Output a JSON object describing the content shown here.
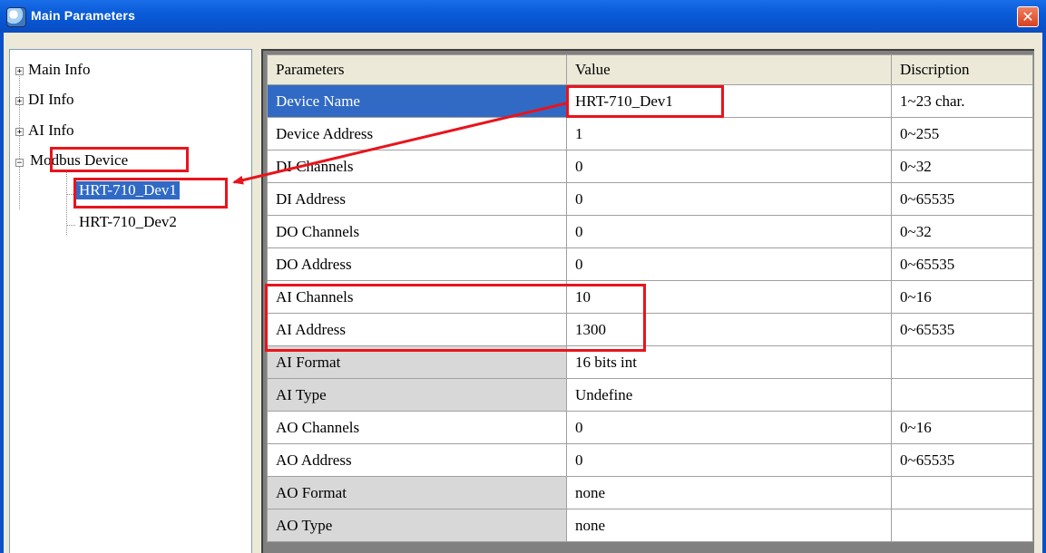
{
  "window": {
    "title": "Main Parameters",
    "close_glyph": "✕"
  },
  "tree": {
    "items": [
      {
        "label": "Main Info",
        "expander": "+"
      },
      {
        "label": "DI Info",
        "expander": "+"
      },
      {
        "label": "AI Info",
        "expander": "+"
      },
      {
        "label": "Modbus Device",
        "expander": "−"
      },
      {
        "label": "HRT-710_Dev1"
      },
      {
        "label": "HRT-710_Dev2"
      }
    ]
  },
  "grid": {
    "headers": [
      "Parameters",
      "Value",
      "Discription"
    ],
    "rows": [
      {
        "param": "Device Name",
        "value": "HRT-710_Dev1",
        "desc": "1~23 char."
      },
      {
        "param": "Device Address",
        "value": "1",
        "desc": "0~255"
      },
      {
        "param": "DI Channels",
        "value": "0",
        "desc": "0~32"
      },
      {
        "param": "DI Address",
        "value": "0",
        "desc": "0~65535"
      },
      {
        "param": "DO Channels",
        "value": "0",
        "desc": "0~32"
      },
      {
        "param": "DO Address",
        "value": "0",
        "desc": "0~65535"
      },
      {
        "param": "AI Channels",
        "value": "10",
        "desc": "0~16"
      },
      {
        "param": "AI Address",
        "value": "1300",
        "desc": "0~65535"
      },
      {
        "param": "AI Format",
        "value": "16 bits int",
        "desc": ""
      },
      {
        "param": "AI Type",
        "value": "Undefine",
        "desc": ""
      },
      {
        "param": "AO Channels",
        "value": "0",
        "desc": "0~16"
      },
      {
        "param": "AO Address",
        "value": "0",
        "desc": "0~65535"
      },
      {
        "param": "AO Format",
        "value": "none",
        "desc": ""
      },
      {
        "param": "AO Type",
        "value": "none",
        "desc": ""
      }
    ]
  },
  "colors": {
    "titlebar": "#0a5bd8",
    "selection": "#316ac5",
    "readonly_cell": "#d8d8d8",
    "annotation": "#e8141c"
  },
  "icons": [
    "app-icon",
    "close-icon",
    "expand-plus-icon",
    "collapse-minus-icon"
  ]
}
